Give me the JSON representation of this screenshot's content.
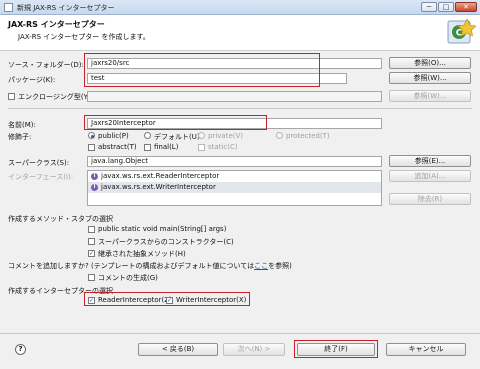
{
  "window": {
    "title": "新規 JAX-RS インターセプター",
    "min": "─",
    "max": "□",
    "close": "✕"
  },
  "banner": {
    "heading": "JAX-RS インターセプター",
    "description": "JAX-RS インターセプター を作成します。"
  },
  "source_folder": {
    "label": "ソース・フォルダー(D):",
    "value": "jaxrs20/src",
    "button": "参照(O)..."
  },
  "package": {
    "label": "パッケージ(K):",
    "value": "test",
    "button": "参照(W)..."
  },
  "enclosing": {
    "label": "エンクロージング型(Y):",
    "value": "",
    "button": "参照(W)..."
  },
  "name": {
    "label": "名前(M):",
    "value": "Jaxrs20Interceptor"
  },
  "modifiers": {
    "label": "修飾子:",
    "public": "public(P)",
    "default": "デフォルト(U)",
    "private": "private(V)",
    "protected": "protected(T)",
    "abstract": "abstract(T)",
    "final": "final(L)",
    "static": "static(C)"
  },
  "superclass": {
    "label": "スーパークラス(S):",
    "value": "java.lang.Object",
    "button": "参照(E)..."
  },
  "interfaces": {
    "label": "インターフェース(I):",
    "items": [
      "javax.ws.rs.ext.ReaderInterceptor",
      "javax.ws.rs.ext.WriterInterceptor"
    ],
    "add_button": "追加(A)...",
    "remove_button": "除去(R)"
  },
  "stubs": {
    "heading": "作成するメソッド・スタブの選択",
    "main": "public static void main(String[] args)",
    "constructors": "スーパークラスからのコンストラクター(C)",
    "inherited": "継承された抽象メソッド(H)"
  },
  "comments": {
    "prefix": "コメントを追加しますか? (テンプレートの構成およびデフォルト値については",
    "link": "ここ",
    "suffix": "を参照)",
    "generate": "コメントの生成(G)"
  },
  "interceptors": {
    "heading": "作成するインターセプターの選択",
    "reader": "ReaderInterceptor(Z)",
    "writer": "WriterInterceptor(X)"
  },
  "footer": {
    "help": "?",
    "back": "< 戻る(B)",
    "next": "次へ(N) >",
    "finish": "終了(F)",
    "cancel": "キャンセル"
  },
  "checkmark": "✓"
}
